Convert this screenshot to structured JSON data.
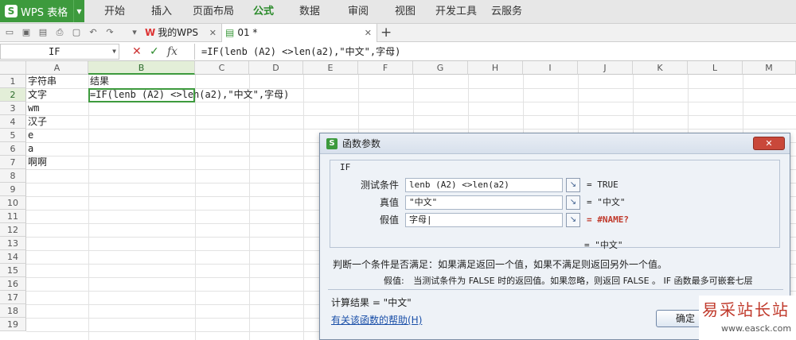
{
  "app": {
    "name": "WPS 表格",
    "logo": "S"
  },
  "menu": [
    "开始",
    "插入",
    "页面布局",
    "公式",
    "数据",
    "审阅",
    "视图",
    "开发工具",
    "云服务"
  ],
  "menu_active": "公式",
  "tabs": {
    "wps_tab": "我的WPS",
    "doc_tab": "01 *",
    "new_tab": "+"
  },
  "formula_bar": {
    "name_box": "IF",
    "cancel": "✕",
    "confirm": "✓",
    "fx": "fx",
    "formula": "=IF(lenb (A2) <>len(a2),\"中文\",字母)"
  },
  "sheet": {
    "columns": [
      "A",
      "B",
      "C",
      "D",
      "E",
      "F",
      "G",
      "H",
      "I",
      "J",
      "K",
      "L",
      "M"
    ],
    "rows": [
      "1",
      "2",
      "3",
      "4",
      "5",
      "6",
      "7",
      "8",
      "9",
      "10",
      "11",
      "12",
      "13",
      "14",
      "15",
      "16",
      "17",
      "18",
      "19"
    ],
    "selected_column": "B",
    "selected_row": "2",
    "cells": {
      "A1": "字符串",
      "B1": "结果",
      "A2": "文字",
      "B2": "=IF(lenb (A2) <>len(a2),\"中文\",字母)",
      "A3": "wm",
      "A4": "汉子",
      "A5": "e",
      "A6": "a",
      "A7": "啊啊"
    }
  },
  "dialog": {
    "title": "函数参数",
    "close": "✕",
    "function": "IF",
    "args": [
      {
        "label": "测试条件",
        "value": "lenb (A2) <>len(a2)",
        "result": "= TRUE",
        "error": false
      },
      {
        "label": "真值",
        "value": "\"中文\"",
        "result": "= \"中文\"",
        "error": false
      },
      {
        "label": "假值",
        "value": "字母|",
        "result": "= #NAME?",
        "error": true
      }
    ],
    "overall_result": "= \"中文\"",
    "description": "判断一个条件是否满足：如果满足返回一个值，如果不满足则返回另外一个值。",
    "arg_help_label": "假值:",
    "arg_help": "当测试条件为 FALSE 时的返回值。如果忽略，则返回 FALSE 。 IF 函数最多可嵌套七层",
    "calc_result": "计算结果 = \"中文\"",
    "help_link": "有关该函数的帮助(H)",
    "ok_button": "确定"
  },
  "watermark": {
    "text": "易采站长站",
    "url": "www.easck.com"
  }
}
